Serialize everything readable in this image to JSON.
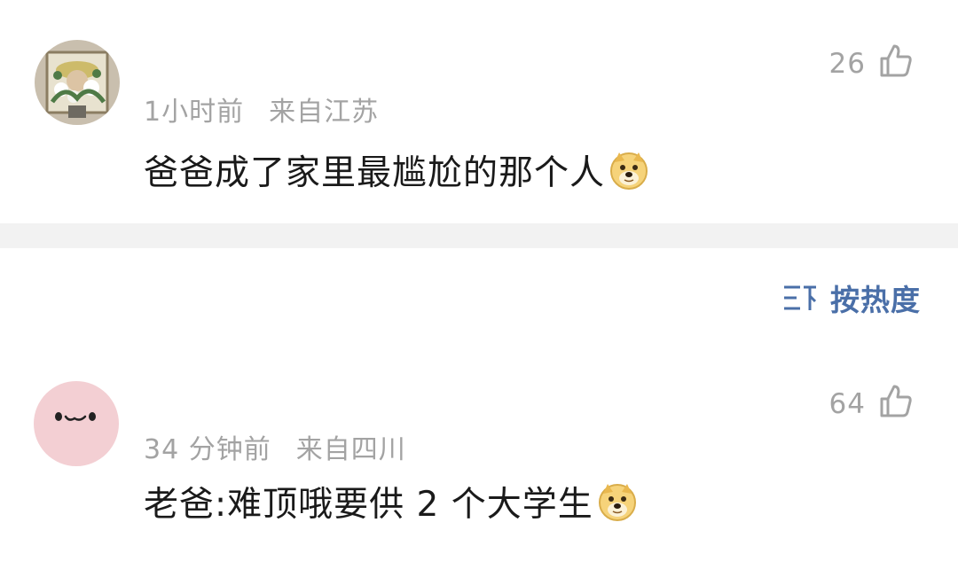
{
  "comments": [
    {
      "time": "1小时前",
      "location": "来自江苏",
      "text": "爸爸成了家里最尴尬的那个人",
      "emoji": "doge-emoji",
      "likes": "26",
      "avatar": "painting-avatar"
    },
    {
      "time": "34 分钟前",
      "location": "来自四川",
      "text": "老爸:难顶哦要供 2 个大学生",
      "emoji": "doge-emoji",
      "likes": "64",
      "avatar": "pink-face-avatar"
    }
  ],
  "sort": {
    "label": "按热度",
    "icon": "sort-icon"
  },
  "colors": {
    "meta_text": "#a3a3a3",
    "body_text": "#1a1a1a",
    "sort_text": "#4a6fa8",
    "divider": "#f2f2f2",
    "avatar_pink": "#f3cfd3"
  }
}
